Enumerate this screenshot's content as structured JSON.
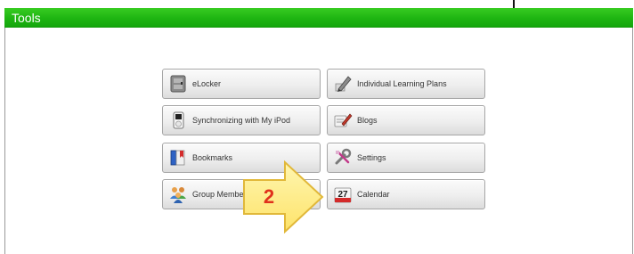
{
  "header": {
    "title": "Tools"
  },
  "tools": {
    "elocker": {
      "label": "eLocker",
      "icon": "locker-icon"
    },
    "ilp": {
      "label": "Individual Learning Plans",
      "icon": "pencil-icon"
    },
    "ipod": {
      "label": "Synchronizing with My iPod",
      "icon": "ipod-icon"
    },
    "blogs": {
      "label": "Blogs",
      "icon": "blog-icon"
    },
    "bookmarks": {
      "label": "Bookmarks",
      "icon": "book-icon"
    },
    "settings": {
      "label": "Settings",
      "icon": "wrench-icon"
    },
    "group": {
      "label": "Group Membe",
      "icon": "group-icon"
    },
    "calendar": {
      "label": "Calendar",
      "icon": "calendar-icon",
      "day": "27"
    }
  },
  "callout": {
    "number": "2"
  }
}
